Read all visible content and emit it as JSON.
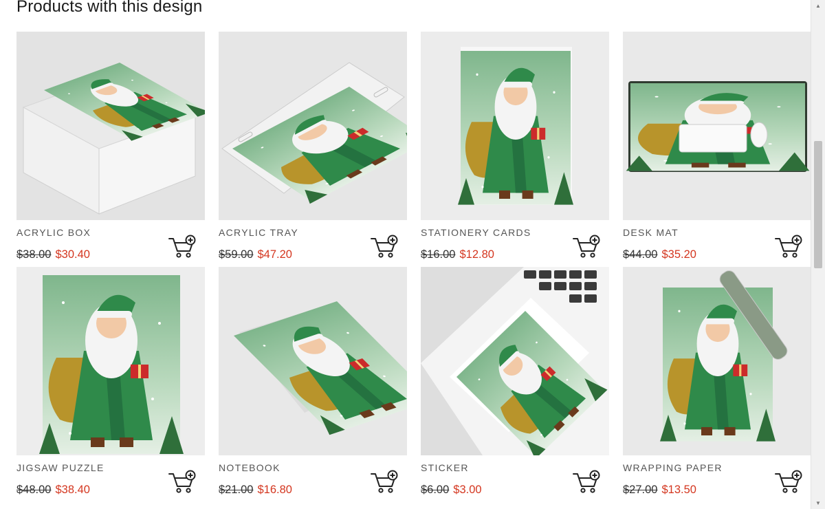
{
  "section": {
    "title": "Products with this design"
  },
  "products": [
    {
      "name": "ACRYLIC BOX",
      "old_price": "$38.00",
      "new_price": "$30.40",
      "image": "acrylic-box"
    },
    {
      "name": "ACRYLIC TRAY",
      "old_price": "$59.00",
      "new_price": "$47.20",
      "image": "acrylic-tray"
    },
    {
      "name": "STATIONERY CARDS",
      "old_price": "$16.00",
      "new_price": "$12.80",
      "image": "stationery-cards"
    },
    {
      "name": "DESK MAT",
      "old_price": "$44.00",
      "new_price": "$35.20",
      "image": "desk-mat"
    },
    {
      "name": "JIGSAW PUZZLE",
      "old_price": "$48.00",
      "new_price": "$38.40",
      "image": "jigsaw-puzzle"
    },
    {
      "name": "NOTEBOOK",
      "old_price": "$21.00",
      "new_price": "$16.80",
      "image": "notebook"
    },
    {
      "name": "STICKER",
      "old_price": "$6.00",
      "new_price": "$3.00",
      "image": "sticker"
    },
    {
      "name": "WRAPPING PAPER",
      "old_price": "$27.00",
      "new_price": "$13.50",
      "image": "wrapping-paper"
    }
  ],
  "icons": {
    "cart": "add-to-cart-icon",
    "scroll_up": "scroll-up-arrow",
    "scroll_down": "scroll-down-arrow"
  },
  "colors": {
    "sale_price": "#d4361f",
    "santa_green": "#2f8a4a",
    "background_green": "#9fc9a6"
  }
}
